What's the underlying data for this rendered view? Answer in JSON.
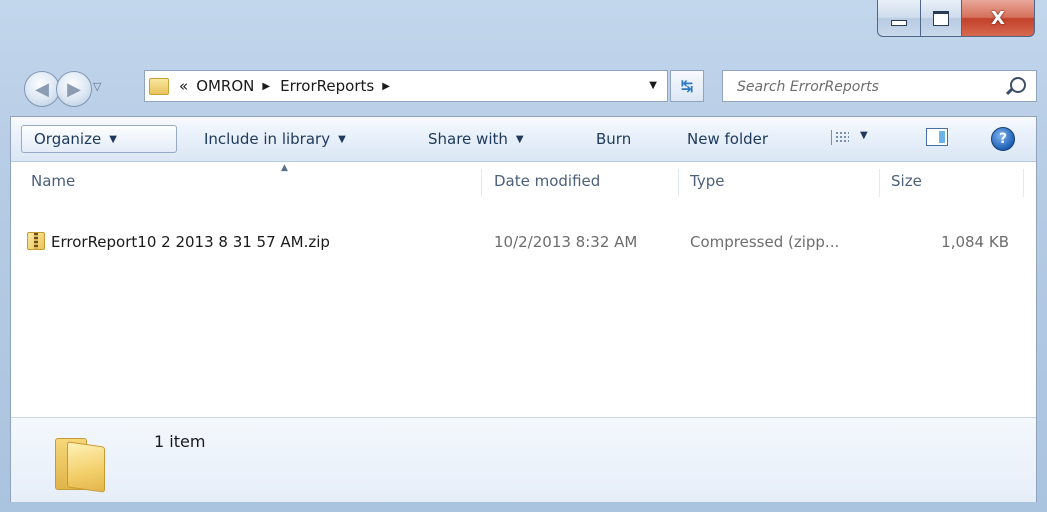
{
  "window": {
    "controls": {
      "minimize_icon": "minimize-icon",
      "maximize_icon": "maximize-icon",
      "close_glyph": "X"
    }
  },
  "nav": {
    "address": {
      "overflow": "«",
      "crumbs": [
        "OMRON",
        "ErrorReports"
      ]
    },
    "search": {
      "placeholder": "Search ErrorReports"
    }
  },
  "toolbar": {
    "organize": "Organize",
    "include_in_library": "Include in library",
    "share_with": "Share with",
    "burn": "Burn",
    "new_folder": "New folder",
    "help_glyph": "?"
  },
  "columns": {
    "name": "Name",
    "date_modified": "Date modified",
    "type": "Type",
    "size": "Size"
  },
  "files": [
    {
      "name": "ErrorReport10 2 2013 8 31 57 AM.zip",
      "date_modified": "10/2/2013 8:32 AM",
      "type": "Compressed (zipp...",
      "size": "1,084 KB",
      "icon": "zip-folder-icon"
    }
  ],
  "details": {
    "item_count": "1 item",
    "icon": "folder-icon"
  },
  "colors": {
    "frame": "#b5cbe4",
    "toolbar_text": "#1e395b",
    "close_button": "#c2402a"
  }
}
